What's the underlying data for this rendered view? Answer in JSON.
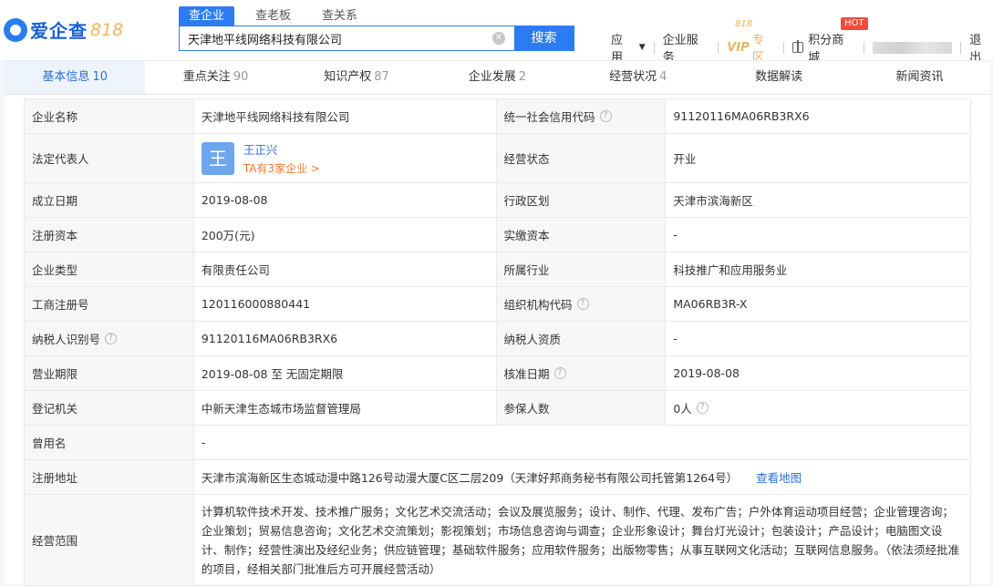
{
  "header": {
    "logo_text": "爱企查",
    "logo_badge": "818",
    "search_tabs": [
      "查企业",
      "查老板",
      "查关系"
    ],
    "search_value": "天津地平线网络科技有限公司",
    "search_button": "搜索",
    "nav": {
      "app": "应用",
      "enterprise_service": "企业服务",
      "vip": "VIP",
      "vip_zone": "专区",
      "vip_818": "818",
      "points_mall": "积分商城",
      "hot": "HOT",
      "logout": "退出"
    }
  },
  "tabs": [
    {
      "label": "基本信息",
      "count": "10"
    },
    {
      "label": "重点关注",
      "count": "90"
    },
    {
      "label": "知识产权",
      "count": "87"
    },
    {
      "label": "企业发展",
      "count": "2"
    },
    {
      "label": "经营状况",
      "count": "4"
    },
    {
      "label": "数据解读",
      "count": ""
    },
    {
      "label": "新闻资讯",
      "count": ""
    }
  ],
  "info": {
    "company_name_label": "企业名称",
    "company_name": "天津地平线网络科技有限公司",
    "credit_code_label": "统一社会信用代码",
    "credit_code": "91120116MA06RB3RX6",
    "legal_rep_label": "法定代表人",
    "legal_rep_avatar": "王",
    "legal_rep_name": "王正兴",
    "legal_rep_sub": "TA有3家企业 >",
    "status_label": "经营状态",
    "status": "开业",
    "founded_label": "成立日期",
    "founded": "2019-08-08",
    "region_label": "行政区划",
    "region": "天津市滨海新区",
    "capital_label": "注册资本",
    "capital": "200万(元)",
    "paid_capital_label": "实缴资本",
    "paid_capital": "-",
    "type_label": "企业类型",
    "type": "有限责任公司",
    "industry_label": "所属行业",
    "industry": "科技推广和应用服务业",
    "reg_no_label": "工商注册号",
    "reg_no": "120116000880441",
    "org_code_label": "组织机构代码",
    "org_code": "MA06RB3R-X",
    "taxpayer_id_label": "纳税人识别号",
    "taxpayer_id": "91120116MA06RB3RX6",
    "taxpayer_qual_label": "纳税人资质",
    "taxpayer_qual": "-",
    "term_label": "营业期限",
    "term": "2019-08-08 至 无固定期限",
    "approval_date_label": "核准日期",
    "approval_date": "2019-08-08",
    "authority_label": "登记机关",
    "authority": "中新天津生态城市场监督管理局",
    "insured_label": "参保人数",
    "insured": "0人",
    "former_name_label": "曾用名",
    "former_name": "-",
    "address_label": "注册地址",
    "address": "天津市滨海新区生态城动漫中路126号动漫大厦C区二层209（天津好邦商务秘书有限公司托管第1264号）",
    "map_link": "查看地图",
    "scope_label": "经营范围",
    "scope": "计算机软件技术开发、技术推广服务；文化艺术交流活动；会议及展览服务；设计、制作、代理、发布广告；户外体育运动项目经营；企业管理咨询；企业策划；贸易信息咨询；文化艺术交流策划；影视策划；市场信息咨询与调查；企业形象设计；舞台灯光设计；包装设计；产品设计；电脑图文设计、制作；经营性演出及经纪业务；供应链管理；基础软件服务；应用软件服务；出版物零售；从事互联网文化活动；互联网信息服务。（依法须经批准的项目，经相关部门批准后方可开展经营活动）"
  }
}
